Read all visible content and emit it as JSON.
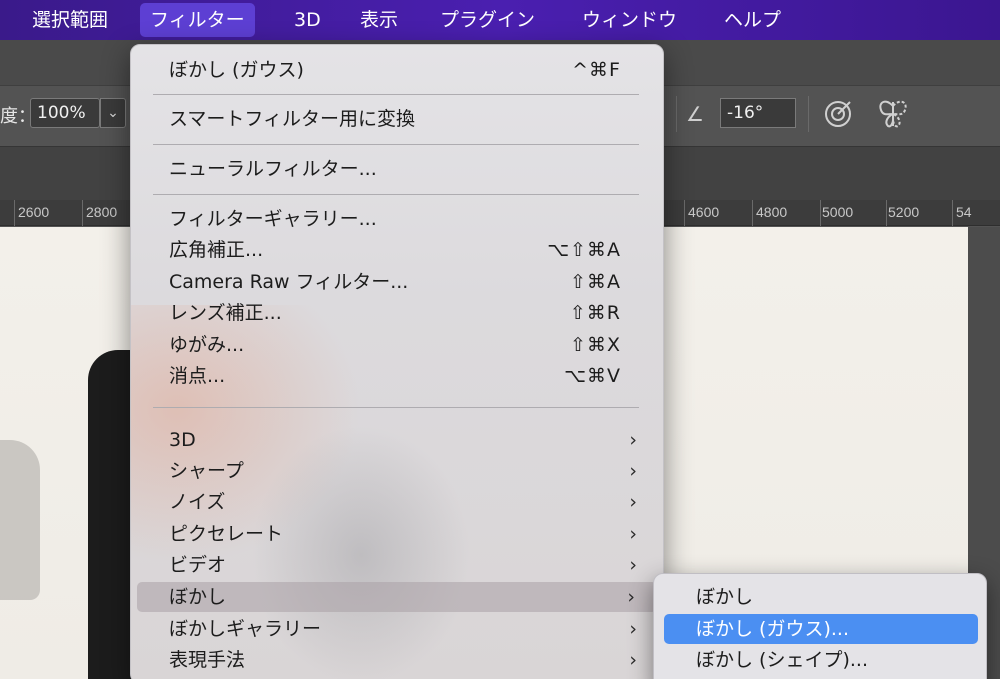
{
  "menubar": {
    "items": [
      {
        "label": "選択範囲"
      },
      {
        "label": "フィルター"
      },
      {
        "label": "3D"
      },
      {
        "label": "表示"
      },
      {
        "label": "プラグイン"
      },
      {
        "label": "ウィンドウ"
      },
      {
        "label": "ヘルプ"
      }
    ],
    "active_index": 1
  },
  "options_bar": {
    "opacity_label": "度：",
    "opacity_value": "100%",
    "dropdown_glyph": "⌄",
    "angle_value": "-16°",
    "angle_icon": "angle-icon",
    "target_icon": "target-icon",
    "butterfly_icon": "symmetry-butterfly-icon"
  },
  "ruler": {
    "ticks": [
      "2600",
      "2800",
      "4600",
      "4800",
      "5000",
      "5200",
      "54"
    ]
  },
  "filter_menu": {
    "items": [
      {
        "label": "ぼかし (ガウス)",
        "shortcut": "^⌘F"
      },
      {
        "label": "スマートフィルター用に変換"
      },
      {
        "label": "ニューラルフィルター..."
      },
      {
        "label": "フィルターギャラリー..."
      },
      {
        "label": "広角補正...",
        "shortcut": "⌥⇧⌘A"
      },
      {
        "label": "Camera Raw フィルター...",
        "shortcut": "⇧⌘A"
      },
      {
        "label": "レンズ補正...",
        "shortcut": "⇧⌘R"
      },
      {
        "label": "ゆがみ...",
        "shortcut": "⇧⌘X"
      },
      {
        "label": "消点...",
        "shortcut": "⌥⌘V"
      },
      {
        "label": "3D",
        "submenu": true
      },
      {
        "label": "シャープ",
        "submenu": true
      },
      {
        "label": "ノイズ",
        "submenu": true
      },
      {
        "label": "ピクセレート",
        "submenu": true
      },
      {
        "label": "ビデオ",
        "submenu": true
      },
      {
        "label": "ぼかし",
        "submenu": true,
        "highlighted": true
      },
      {
        "label": "ぼかしギャラリー",
        "submenu": true
      },
      {
        "label": "表現手法",
        "submenu": true
      }
    ],
    "submenu_arrow": "›"
  },
  "blur_submenu": {
    "items": [
      {
        "label": "ぼかし"
      },
      {
        "label": "ぼかし (ガウス)...",
        "selected": true
      },
      {
        "label": "ぼかし (シェイプ)..."
      }
    ]
  },
  "colors": {
    "menubar": "#4a1fb0",
    "selection": "#4b8ff2"
  }
}
